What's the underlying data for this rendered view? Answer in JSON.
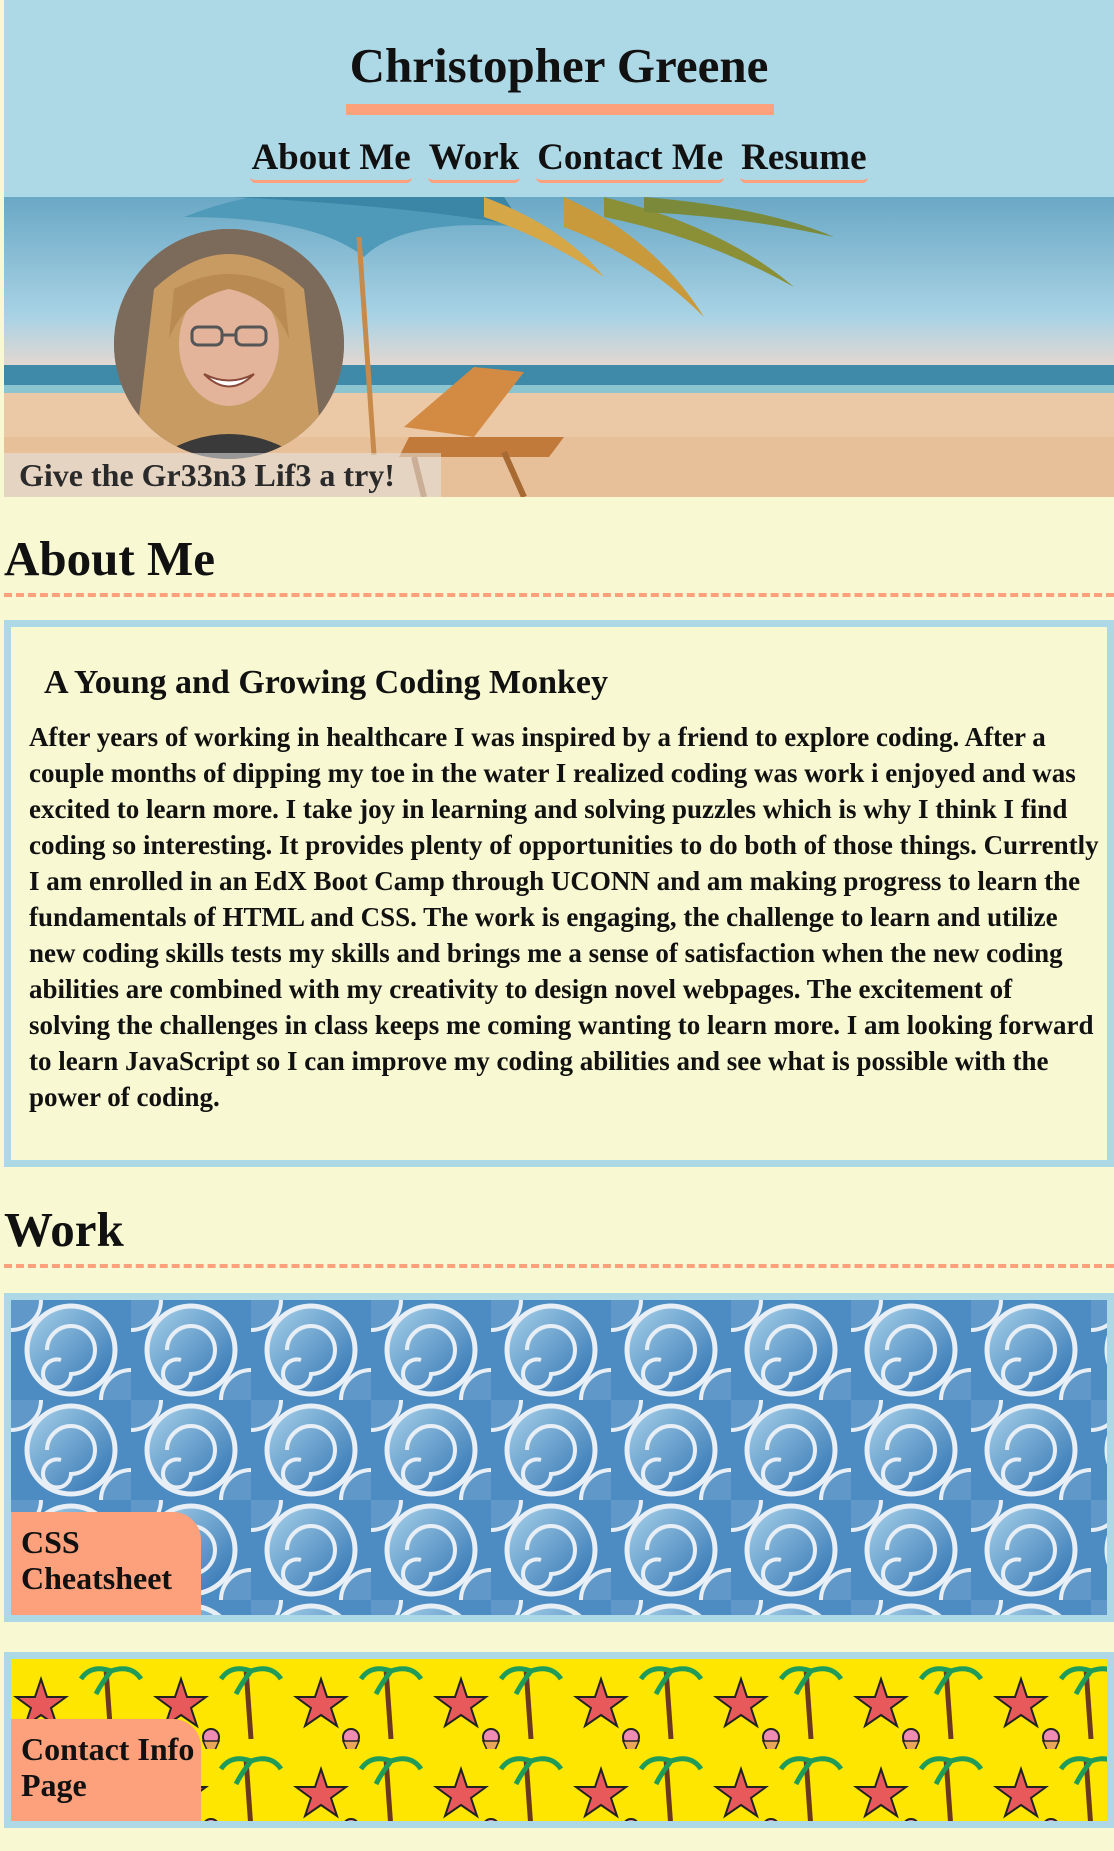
{
  "header": {
    "title": "Christopher Greene",
    "nav": [
      "About Me",
      "Work",
      "Contact Me",
      "Resume"
    ]
  },
  "hero": {
    "tagline": "Give the Gr33n3 Lif3 a try!"
  },
  "about": {
    "heading": "About Me",
    "subtitle": "A Young and Growing Coding Monkey",
    "paragraph": "After years of working in healthcare I was inspired by a friend to explore coding. After a couple months of dipping my toe in the water I realized coding was work i enjoyed and was excited to learn more. I take joy in learning and solving puzzles which is why I think I find coding so interesting. It provides plenty of opportunities to do both of those things. Currently I am enrolled in an EdX Boot Camp through UCONN and am making progress to learn the fundamentals of HTML and CSS. The work is engaging, the challenge to learn and utilize new coding skills tests my skills and brings me a sense of satisfaction when the new coding abilities are combined with my creativity to design novel webpages. The excitement of solving the challenges in class keeps me coming wanting to learn more. I am looking forward to learn JavaScript so I can improve my coding abilities and see what is possible with the power of coding."
  },
  "work": {
    "heading": "Work",
    "cards": [
      {
        "label": "CSS Cheatsheet"
      },
      {
        "label": "Contact Info Page"
      }
    ]
  },
  "colors": {
    "header_bg": "#add8e6",
    "page_bg": "#f8f8d2",
    "accent": "#fda07c",
    "border": "#add8e6",
    "card2_bg": "#ffe600"
  }
}
